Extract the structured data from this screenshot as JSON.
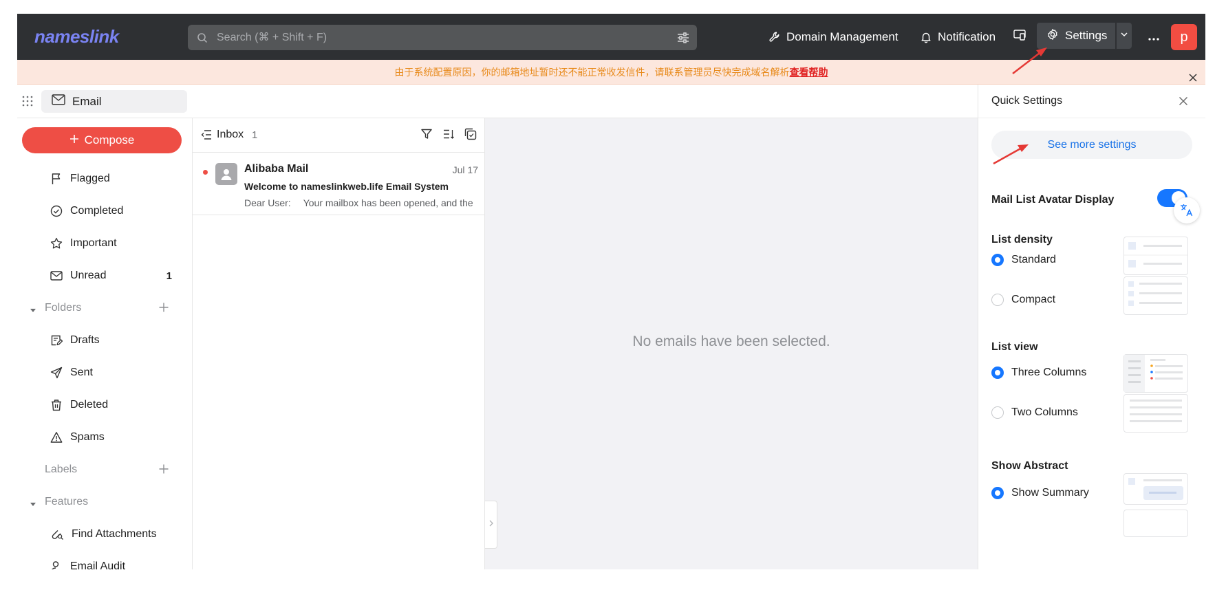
{
  "topbar": {
    "logo_text": "nameslink",
    "search_placeholder": "Search (⌘ + Shift + F)",
    "domain_management": "Domain Management",
    "notification": "Notification",
    "settings": "Settings",
    "avatar_letter": "p"
  },
  "notice": {
    "message": "由于系统配置原因，你的邮箱地址暂时还不能正常收发信件，请联系管理员尽快完成域名解析",
    "help_link": "查看帮助"
  },
  "app_tab": {
    "label": "Email"
  },
  "sidebar": {
    "compose": "Compose",
    "items": [
      {
        "label": "Flagged",
        "icon": "flag-icon"
      },
      {
        "label": "Completed",
        "icon": "check-circle-icon"
      },
      {
        "label": "Important",
        "icon": "star-icon"
      },
      {
        "label": "Unread",
        "icon": "envelope-icon",
        "count": "1"
      }
    ],
    "folders_label": "Folders",
    "folders": [
      {
        "label": "Drafts",
        "icon": "draft-icon"
      },
      {
        "label": "Sent",
        "icon": "send-icon"
      },
      {
        "label": "Deleted",
        "icon": "trash-icon"
      },
      {
        "label": "Spams",
        "icon": "warning-icon"
      }
    ],
    "labels_label": "Labels",
    "features_label": "Features",
    "features": [
      {
        "label": "Find Attachments",
        "icon": "attachment-search-icon"
      },
      {
        "label": "Email Audit",
        "icon": "audit-icon"
      }
    ]
  },
  "list": {
    "title": "Inbox",
    "count": "1",
    "mails": [
      {
        "sender": "Alibaba Mail",
        "date": "Jul 17",
        "subject": "Welcome to nameslinkweb.life Email System",
        "preview_greeting": "Dear User:",
        "preview_body": "Your mailbox has been opened, and the"
      }
    ]
  },
  "reading": {
    "empty_text": "No emails have been selected."
  },
  "quick_settings": {
    "title": "Quick Settings",
    "see_more": "See more settings",
    "avatar_display_label": "Mail List Avatar Display",
    "avatar_display_on": true,
    "list_density_label": "List density",
    "density_options": [
      {
        "label": "Standard",
        "selected": true
      },
      {
        "label": "Compact",
        "selected": false
      }
    ],
    "list_view_label": "List view",
    "view_options": [
      {
        "label": "Three Columns",
        "selected": true
      },
      {
        "label": "Two Columns",
        "selected": false
      }
    ],
    "show_abstract_label": "Show Abstract",
    "abstract_options": [
      {
        "label": "Show Summary",
        "selected": true
      }
    ]
  },
  "colors": {
    "topbar_bg": "#2e3033",
    "accent_red": "#ee4e45",
    "accent_blue": "#1677ff",
    "notice_bg": "#fce7de",
    "annotation_arrow": "#e53935"
  }
}
